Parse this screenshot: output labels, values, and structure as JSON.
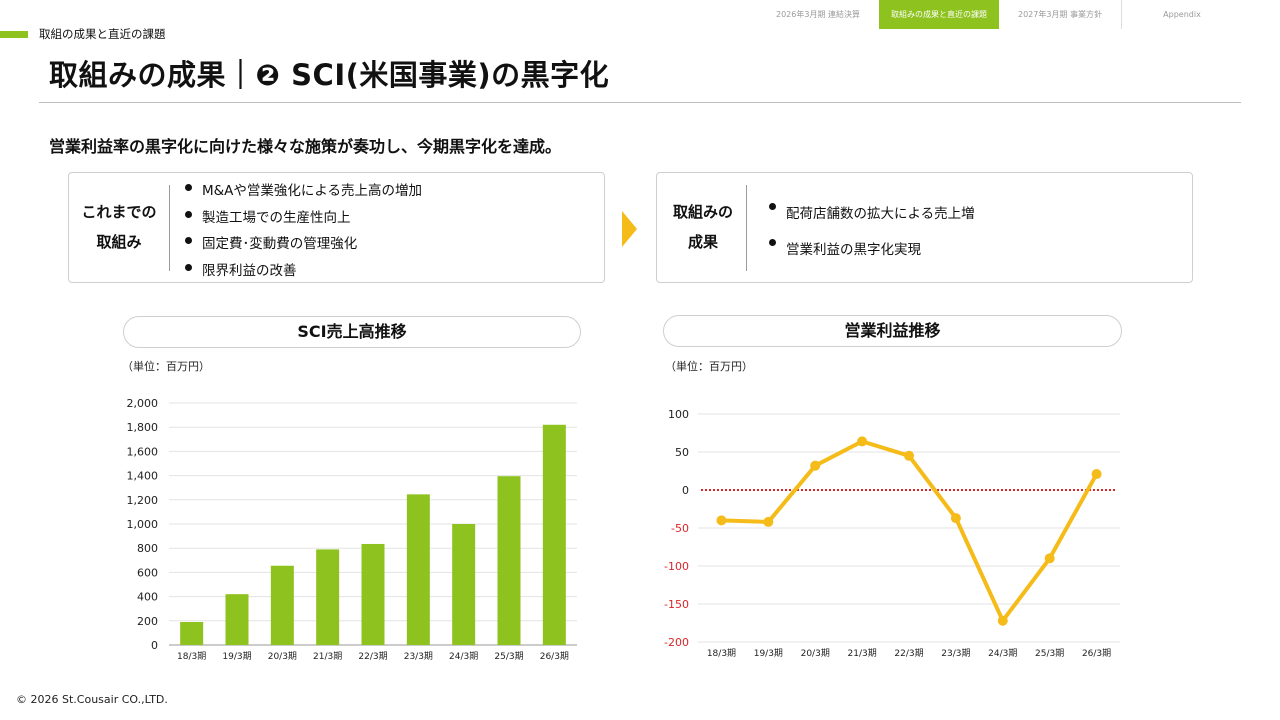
{
  "nav": {
    "tabs": [
      {
        "label": "2026年3月期 連結決算",
        "active": false
      },
      {
        "label": "取組みの成果と直近の課題",
        "active": true
      },
      {
        "label": "2027年3月期  事業方針",
        "active": false
      },
      {
        "label": "Appendix",
        "active": false
      }
    ]
  },
  "section_label": "取組の成果と直近の課題",
  "page_title": "取組みの成果｜❷ SCI(米国事業)の黒字化",
  "lead": "営業利益率の黒字化に向けた様々な施策が奏功し、今期黒字化を達成。",
  "before_box": {
    "heading_line1": "これまでの",
    "heading_line2": "取組み",
    "items": [
      "M&Aや営業強化による売上高の増加",
      "製造工場での生産性向上",
      "固定費･変動費の管理強化",
      "限界利益の改善"
    ]
  },
  "after_box": {
    "heading_line1": "取組みの",
    "heading_line2": "成果",
    "items": [
      "配荷店舗数の拡大による売上増",
      "営業利益の黒字化実現"
    ]
  },
  "colors": {
    "accent_green": "#8dc21f",
    "arrow_yellow": "#f5bb19",
    "line_yellow": "#f5bb19",
    "zero_line_red": "#d9262b",
    "negative_tick_red": "#d9262b"
  },
  "chart_data": [
    {
      "type": "bar",
      "title": "SCI売上高推移",
      "unit_label": "（単位：百万円）",
      "categories": [
        "18/3期",
        "19/3期",
        "20/3期",
        "21/3期",
        "22/3期",
        "23/3期",
        "24/3期",
        "25/3期",
        "26/3期"
      ],
      "values": [
        190,
        420,
        655,
        790,
        835,
        1245,
        1000,
        1395,
        1820
      ],
      "ylim": [
        0,
        2000
      ],
      "yticks": [
        0,
        200,
        400,
        600,
        800,
        1000,
        1200,
        1400,
        1600,
        1800,
        2000
      ],
      "ytick_labels": [
        "0",
        "200",
        "400",
        "600",
        "800",
        "1,000",
        "1,200",
        "1,400",
        "1,600",
        "1,800",
        "2,000"
      ],
      "grid": true,
      "color": "#8dc21f"
    },
    {
      "type": "line",
      "title": "営業利益推移",
      "unit_label": "（単位：百万円）",
      "categories": [
        "18/3期",
        "19/3期",
        "20/3期",
        "21/3期",
        "22/3期",
        "23/3期",
        "24/3期",
        "25/3期",
        "26/3期"
      ],
      "values": [
        -40,
        -42,
        32,
        64,
        45,
        -37,
        -172,
        -90,
        21
      ],
      "ylim": [
        -200,
        100
      ],
      "yticks": [
        -200,
        -150,
        -100,
        -50,
        0,
        50,
        100
      ],
      "ytick_labels": [
        "-200",
        "-150",
        "-100",
        "-50",
        "0",
        "50",
        "100"
      ],
      "grid": true,
      "color": "#f5bb19",
      "zero_reference_line": true
    }
  ],
  "copyright": "© 2026 St.Cousair CO.,LTD."
}
